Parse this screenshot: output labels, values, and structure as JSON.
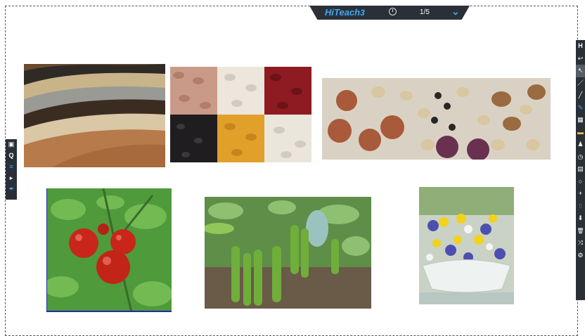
{
  "app": {
    "brand": "HiTeach",
    "brand_version": "3",
    "page_indicator": "1/5",
    "accent_color": "#3fa9f5",
    "bar_color": "#2b3038"
  },
  "left_toolbar": {
    "items": [
      {
        "name": "image-icon",
        "glyph": "▣"
      },
      {
        "name": "quiz-icon",
        "glyph": "Q"
      },
      {
        "name": "menu-icon",
        "glyph": "≡"
      },
      {
        "name": "play-icon",
        "glyph": "▸"
      },
      {
        "name": "arrows-icon",
        "glyph": "◂▸"
      }
    ]
  },
  "right_toolbar": {
    "title": "H",
    "items": [
      {
        "name": "undo-icon",
        "glyph": "↩"
      },
      {
        "name": "pointer-icon",
        "glyph": "↖"
      },
      {
        "name": "pen-icon",
        "glyph": "／"
      },
      {
        "name": "marker-icon",
        "glyph": "╱"
      },
      {
        "name": "highlighter-icon",
        "glyph": "✎"
      },
      {
        "name": "grid-icon",
        "glyph": "▦"
      },
      {
        "name": "eraser-icon",
        "glyph": "▬"
      },
      {
        "name": "group-icon",
        "glyph": "♟"
      },
      {
        "name": "timer-icon",
        "glyph": "◷"
      },
      {
        "name": "chart-icon",
        "glyph": "▤"
      },
      {
        "name": "zoom-icon",
        "glyph": "○"
      },
      {
        "name": "add-icon",
        "glyph": "+"
      },
      {
        "name": "upload-icon",
        "glyph": "⇧"
      },
      {
        "name": "download-icon",
        "glyph": "⬇"
      },
      {
        "name": "trash-icon",
        "glyph": "🗑"
      },
      {
        "name": "random-icon",
        "glyph": "⤨"
      },
      {
        "name": "settings-icon",
        "glyph": "⚙"
      }
    ]
  },
  "images": [
    {
      "id": "img1",
      "subject": "seed-layers"
    },
    {
      "id": "img2",
      "subject": "beans-grid"
    },
    {
      "id": "img3",
      "subject": "bulbs"
    },
    {
      "id": "img4",
      "subject": "tomatoes"
    },
    {
      "id": "img5",
      "subject": "broad-beans"
    },
    {
      "id": "img6",
      "subject": "flower-pot"
    }
  ]
}
